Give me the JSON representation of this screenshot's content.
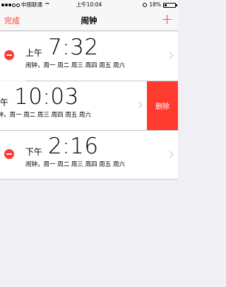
{
  "status_bar": {
    "carrier": "中国联通",
    "time": "上午10:04",
    "battery": "18%",
    "battery_level": 0.18
  },
  "nav": {
    "done_label": "完成",
    "title": "闹钟",
    "add_label": "+"
  },
  "alarms": [
    {
      "ampm": "上午",
      "time": "7:32",
      "subtitle": "闹钟，周一 周二 周三 周四 周五 周六"
    },
    {
      "ampm": "上午",
      "time": "10:03",
      "subtitle": "闹钟，周一 周二 周三 周四 周五 周六"
    },
    {
      "ampm": "下午",
      "time": "2:16",
      "subtitle": "闹钟，周一 周二 周三 周四 周五 周六"
    }
  ],
  "delete_label": "删除",
  "colors": {
    "accent": "#ff3b30",
    "background": "#efeff4"
  }
}
